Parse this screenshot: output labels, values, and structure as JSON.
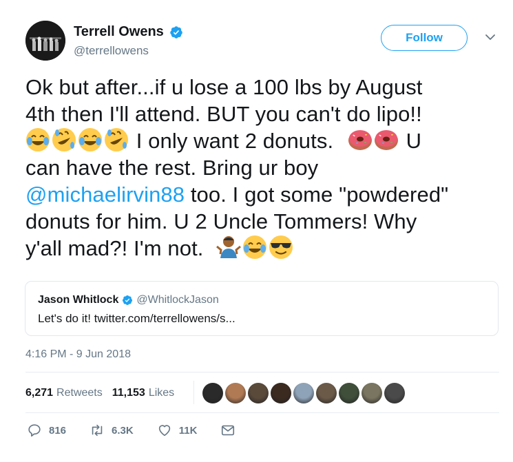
{
  "author": {
    "name": "Terrell Owens",
    "handle": "@terrellowens",
    "verified": true
  },
  "follow_label": "Follow",
  "tweet": {
    "line1": "Ok but after...if u lose a 100 lbs by August",
    "line2": "4th then I'll attend. BUT you can't do lipo!!",
    "line3_text": "I only want 2 donuts.",
    "line3_tail": "U",
    "line4": "can have the rest. Bring ur boy",
    "mention": "@michaelirvin88",
    "line5_tail": "too. I got some \"powdered\"",
    "line6": "donuts for him. U 2 Uncle Tommers! Why",
    "line7": "y'all mad?! I'm not."
  },
  "emojis": [
    "joy",
    "rofl",
    "joy",
    "rofl",
    "doughnut",
    "doughnut",
    "shrug",
    "joy",
    "sunglasses"
  ],
  "quoted": {
    "name": "Jason Whitlock",
    "handle": "@WhitlockJason",
    "verified": true,
    "text": "Let's do it! twitter.com/terrellowens/s..."
  },
  "timestamp": "4:16 PM - 9 Jun 2018",
  "stats": {
    "retweets_count": "6,271",
    "retweets_label": "Retweets",
    "likes_count": "11,153",
    "likes_label": "Likes"
  },
  "liker_colors": [
    "#2a2a2a",
    "#b07a55",
    "#5a4a3a",
    "#3b2a20",
    "#8fa3b8",
    "#6b5a48",
    "#3f4f3a",
    "#7a7560",
    "#4a4a4a"
  ],
  "actions": {
    "replies": "816",
    "retweets": "6.3K",
    "likes": "11K"
  },
  "colors": {
    "accent": "#1da1f2",
    "secondary_text": "#657786",
    "text": "#14171a"
  }
}
